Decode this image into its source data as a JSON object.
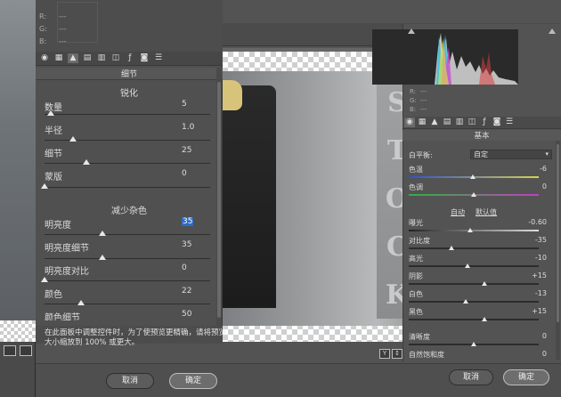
{
  "left_panel": {
    "readout": {
      "r": "R:",
      "g": "G:",
      "b": "B:",
      "dash": "---"
    },
    "section_title": "细节",
    "sharpen_group": "锐化",
    "sharpen": [
      {
        "label": "数量",
        "value": "5",
        "fraction": 0.04
      },
      {
        "label": "半径",
        "value": "1.0",
        "fraction": 0.17
      },
      {
        "label": "细节",
        "value": "25",
        "fraction": 0.25
      },
      {
        "label": "蒙版",
        "value": "0",
        "fraction": 0.0
      }
    ],
    "noise_group": "减少杂色",
    "noise": [
      {
        "label": "明亮度",
        "value": "35",
        "fraction": 0.35,
        "editing": true
      },
      {
        "label": "明亮度细节",
        "value": "35",
        "fraction": 0.35
      },
      {
        "label": "明亮度对比",
        "value": "0",
        "fraction": 0.0
      },
      {
        "label": "颜色",
        "value": "22",
        "fraction": 0.22
      },
      {
        "label": "颜色细节",
        "value": "50",
        "fraction": 0.5
      }
    ],
    "hint": "在此面板中调整控件时，为了使预览更精确，请将预览大小缩放到 100% 或更大。"
  },
  "preview": {
    "stock_letters": [
      "S",
      "T",
      "O",
      "C",
      "K"
    ],
    "tool_labels": [
      "Y",
      "↕",
      "◧",
      "≡"
    ]
  },
  "right_panel": {
    "readout": {
      "r": "R:",
      "g": "G:",
      "b": "B:",
      "dash": "---"
    },
    "section_title": "基本",
    "white_balance_label": "白平衡:",
    "white_balance_value": "自定",
    "temperature": {
      "label": "色温",
      "value": "-6",
      "fraction": 0.49
    },
    "tint": {
      "label": "色调",
      "value": "0",
      "fraction": 0.5
    },
    "auto_label": "自动",
    "default_label": "默认值",
    "tone": [
      {
        "label": "曝光",
        "value": "-0.60",
        "fraction": 0.47
      },
      {
        "label": "对比度",
        "value": "-35",
        "fraction": 0.33
      },
      {
        "label": "高光",
        "value": "-10",
        "fraction": 0.45
      },
      {
        "label": "阴影",
        "value": "+15",
        "fraction": 0.58
      },
      {
        "label": "白色",
        "value": "-13",
        "fraction": 0.44
      },
      {
        "label": "黑色",
        "value": "+15",
        "fraction": 0.58
      }
    ],
    "presence": [
      {
        "label": "清晰度",
        "value": "0",
        "fraction": 0.5
      },
      {
        "label": "自然饱和度",
        "value": "0",
        "fraction": 0.5
      }
    ]
  },
  "footer": {
    "cancel_label": "取消",
    "ok_label": "确定"
  },
  "colors": {
    "panel": "#535353",
    "edit_highlight": "#2b6cc4"
  }
}
